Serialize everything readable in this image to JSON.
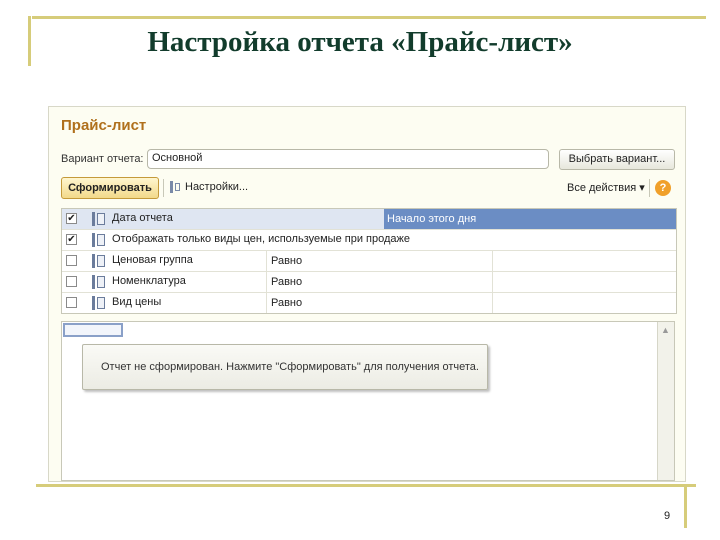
{
  "slide": {
    "title": "Настройка отчета «Прайс-лист»",
    "page_number": "9"
  },
  "form": {
    "title": "Прайс-лист",
    "variant_label": "Вариант отчета:",
    "variant_value": "Основной",
    "select_variant_label": "Выбрать вариант...",
    "generate_label": "Сформировать",
    "settings_label": "Настройки...",
    "all_actions_label": "Все действия ▾",
    "help_label": "?"
  },
  "settings_rows": [
    {
      "checked": "✔",
      "name": "Дата отчета",
      "condition": "",
      "value": "Начало этого дня",
      "selected": true
    },
    {
      "checked": "✔",
      "name": "Отображать только виды цен, используемые при продаже",
      "condition": "",
      "value": "",
      "selected": false
    },
    {
      "checked": "",
      "name": "Ценовая группа",
      "condition": "Равно",
      "value": "",
      "selected": false
    },
    {
      "checked": "",
      "name": "Номенклатура",
      "condition": "Равно",
      "value": "",
      "selected": false
    },
    {
      "checked": "",
      "name": "Вид цены",
      "condition": "Равно",
      "value": "",
      "selected": false
    }
  ],
  "report": {
    "message": "Отчет не сформирован. Нажмите \"Сформировать\" для получения отчета.",
    "scroll_up": "▲"
  },
  "colors": {
    "title_text": "#123c2c",
    "form_title": "#b0701c",
    "accent_border": "#d6cc7a",
    "selection": "#6b8dc4"
  }
}
